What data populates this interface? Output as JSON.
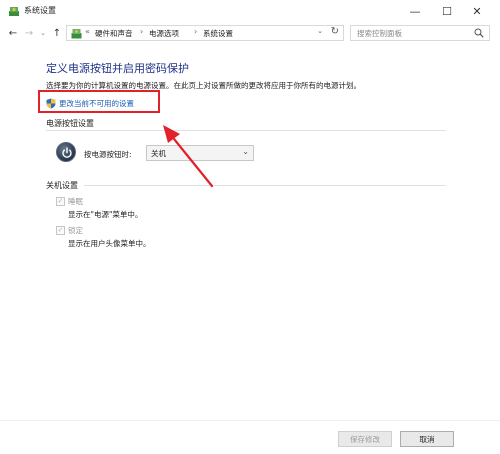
{
  "window": {
    "title": "系统设置",
    "controls": {
      "minimize": "—",
      "maximize": "☐",
      "close": "✕"
    }
  },
  "navigation": {
    "back_icon": "←",
    "forward_icon": "→",
    "history_icon": "⌄",
    "up_icon": "↑",
    "breadcrumbs": [
      "硬件和声音",
      "电源选项",
      "系统设置"
    ],
    "separator": "›",
    "prefix_separator": "«",
    "dropdown_icon": "⌄",
    "refresh_icon": "↻",
    "search_placeholder": "搜索控制面板"
  },
  "content": {
    "heading": "定义电源按钮并启用密码保护",
    "description": "选择要为你的计算机设置的电源设置。在此页上对设置所做的更改将应用于你所有的电源计划。",
    "change_settings_link": "更改当前不可用的设置",
    "power_button_section": {
      "title": "电源按钮设置",
      "label": "按电源按钮时:",
      "selected_value": "关机",
      "chevron": "⌄"
    },
    "shutdown_section": {
      "title": "关机设置",
      "options": [
        {
          "label": "睡眠",
          "sub": "显示在\"电源\"菜单中。",
          "checked": true
        },
        {
          "label": "锁定",
          "sub": "显示在用户头像菜单中。",
          "checked": true
        }
      ]
    }
  },
  "footer": {
    "save_label": "保存修改",
    "cancel_label": "取消"
  },
  "colors": {
    "heading": "#1e3287",
    "link": "#1a5fb4",
    "annotation": "#e0222b"
  }
}
